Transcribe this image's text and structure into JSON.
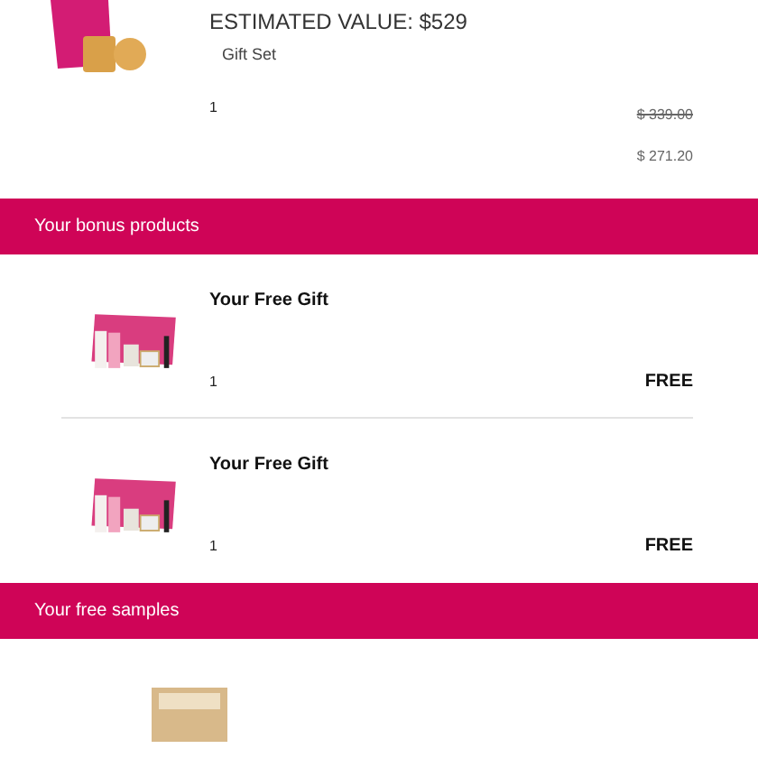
{
  "order_item": {
    "estimated_value": "ESTIMATED VALUE: $529",
    "type": "Gift Set",
    "quantity": "1",
    "original_price": "$ 339.00",
    "price": "$ 271.20"
  },
  "bonus_section": {
    "title": "Your bonus products",
    "items": [
      {
        "name": "Your Free Gift",
        "quantity": "1",
        "price": "FREE"
      },
      {
        "name": "Your Free Gift",
        "quantity": "1",
        "price": "FREE"
      }
    ]
  },
  "samples_section": {
    "title": "Your free samples"
  }
}
